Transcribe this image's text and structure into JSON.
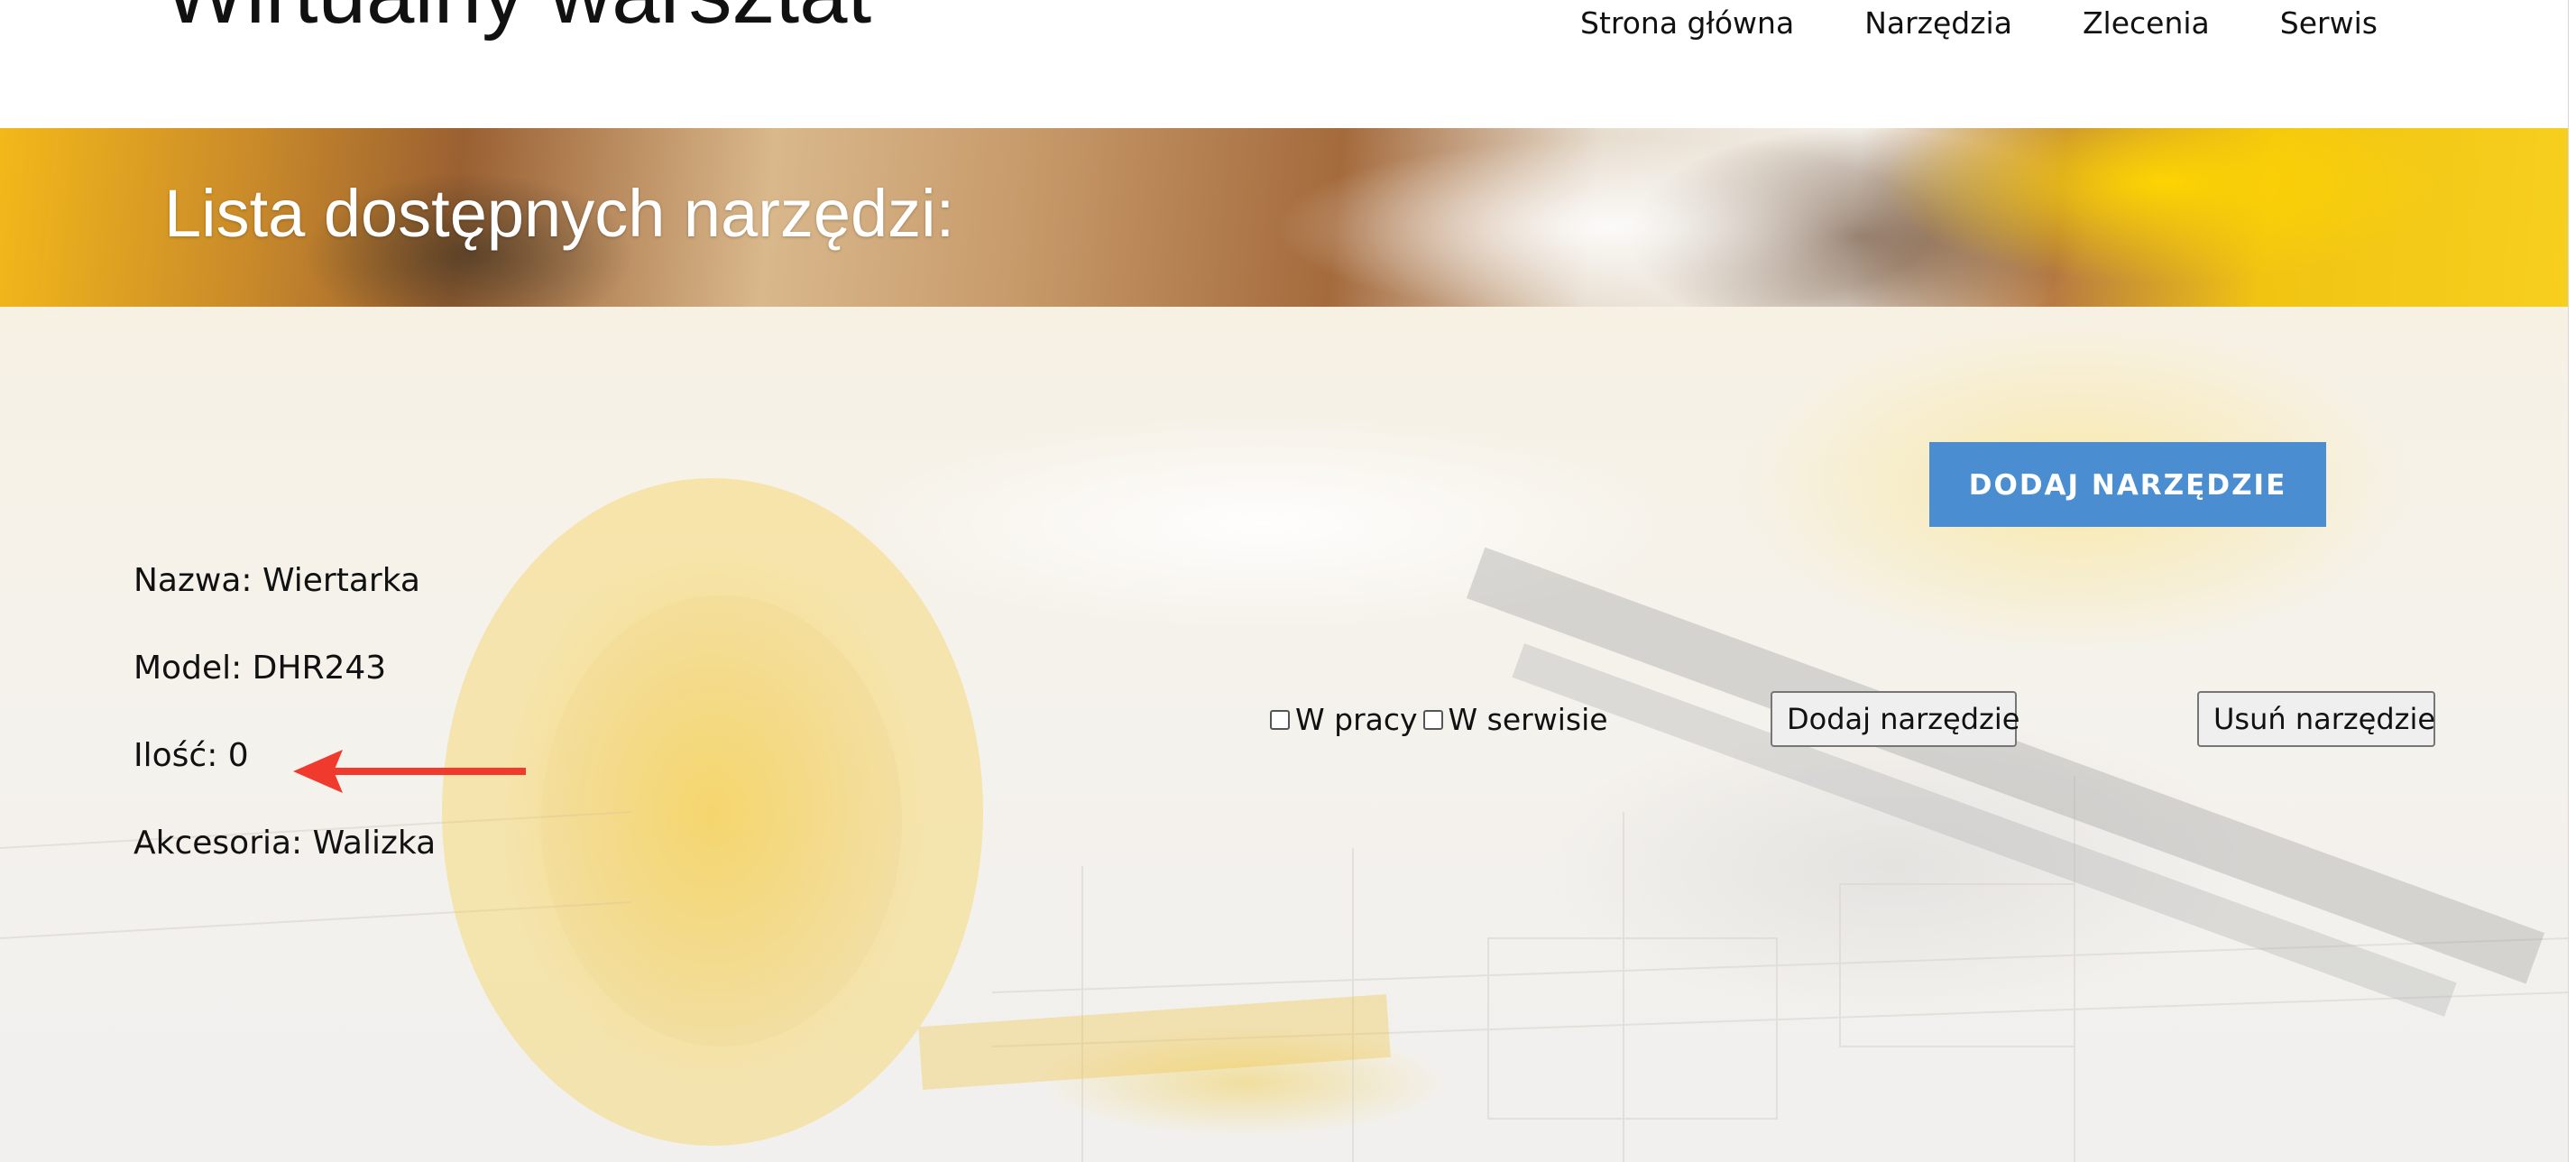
{
  "header": {
    "site_title": "Wirtualny warsztat",
    "nav": [
      {
        "label": "Strona główna"
      },
      {
        "label": "Narzędzia"
      },
      {
        "label": "Zlecenia"
      },
      {
        "label": "Serwis"
      }
    ]
  },
  "hero": {
    "title": "Lista dostępnych narzędzi:"
  },
  "actions": {
    "add_tool_primary": "DODAJ NARZĘDZIE",
    "add_tool_button": "Dodaj narzędzie",
    "remove_tool_button": "Usuń narzędzie"
  },
  "tool": {
    "name": "Nazwa: Wiertarka",
    "model": "Model: DHR243",
    "quantity": "Ilość: 0",
    "accessories": "Akcesoria: Walizka"
  },
  "status": {
    "in_use": {
      "label": "W pracy",
      "checked": false
    },
    "in_service": {
      "label": "W serwisie",
      "checked": false
    }
  },
  "annotation": {
    "arrow_color": "#f03a2e",
    "target": "quantity"
  },
  "colors": {
    "primary_button": "#4a8ed1",
    "hero_text": "#ffffff"
  }
}
